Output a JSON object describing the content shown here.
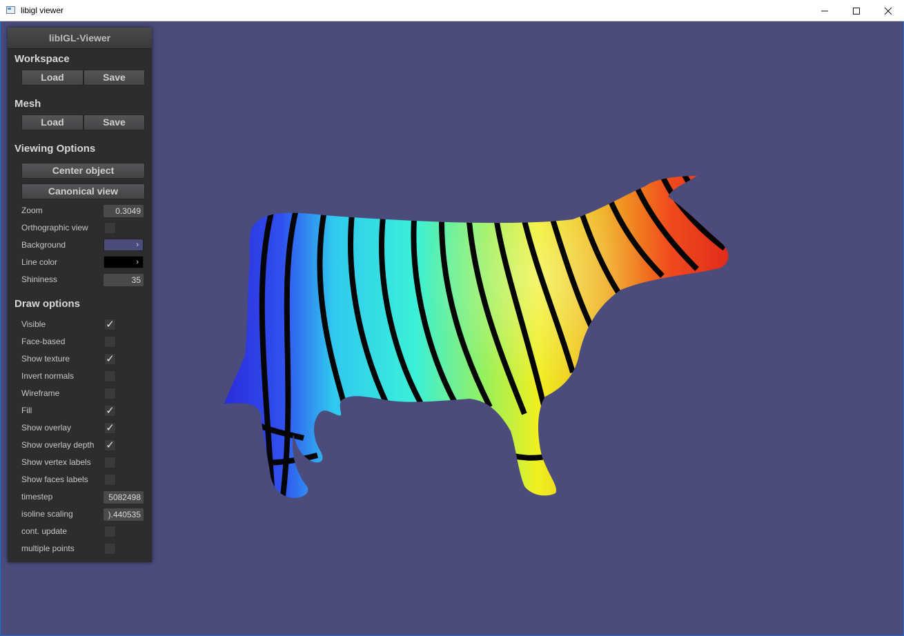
{
  "window": {
    "title": "libigl viewer"
  },
  "panel": {
    "title": "libIGL-Viewer",
    "workspace": {
      "heading": "Workspace",
      "load": "Load",
      "save": "Save"
    },
    "mesh": {
      "heading": "Mesh",
      "load": "Load",
      "save": "Save"
    },
    "viewing": {
      "heading": "Viewing Options",
      "center": "Center object",
      "canonical": "Canonical view",
      "zoom_label": "Zoom",
      "zoom_value": "0.3049",
      "ortho_label": "Orthographic view",
      "ortho_checked": false,
      "background_label": "Background",
      "background_color": "#4b4b7c",
      "linecolor_label": "Line color",
      "linecolor_color": "#000000",
      "shininess_label": "Shininess",
      "shininess_value": "35"
    },
    "draw": {
      "heading": "Draw options",
      "items": [
        {
          "label": "Visible",
          "checked": true
        },
        {
          "label": "Face-based",
          "checked": false
        },
        {
          "label": "Show texture",
          "checked": true
        },
        {
          "label": "Invert normals",
          "checked": false
        },
        {
          "label": "Wireframe",
          "checked": false
        },
        {
          "label": "Fill",
          "checked": true
        },
        {
          "label": "Show overlay",
          "checked": true
        },
        {
          "label": "Show overlay depth",
          "checked": true
        },
        {
          "label": "Show vertex labels",
          "checked": false
        },
        {
          "label": "Show faces labels",
          "checked": false
        }
      ],
      "timestep_label": "timestep",
      "timestep_value": "5082498",
      "isoline_label": "isoline scaling",
      "isoline_value": ").440535",
      "contupdate_label": "cont. update",
      "contupdate_checked": false,
      "multipoints_label": "multiple points",
      "multipoints_checked": false
    }
  },
  "colors": {
    "viewport_bg": "#4b4b7c",
    "panel_bg": "#2d2d2f"
  },
  "icons": {
    "app": "app-window-icon",
    "minimize": "minimize-icon",
    "maximize": "maximize-icon",
    "close": "close-icon",
    "check": "checkmark-icon"
  }
}
